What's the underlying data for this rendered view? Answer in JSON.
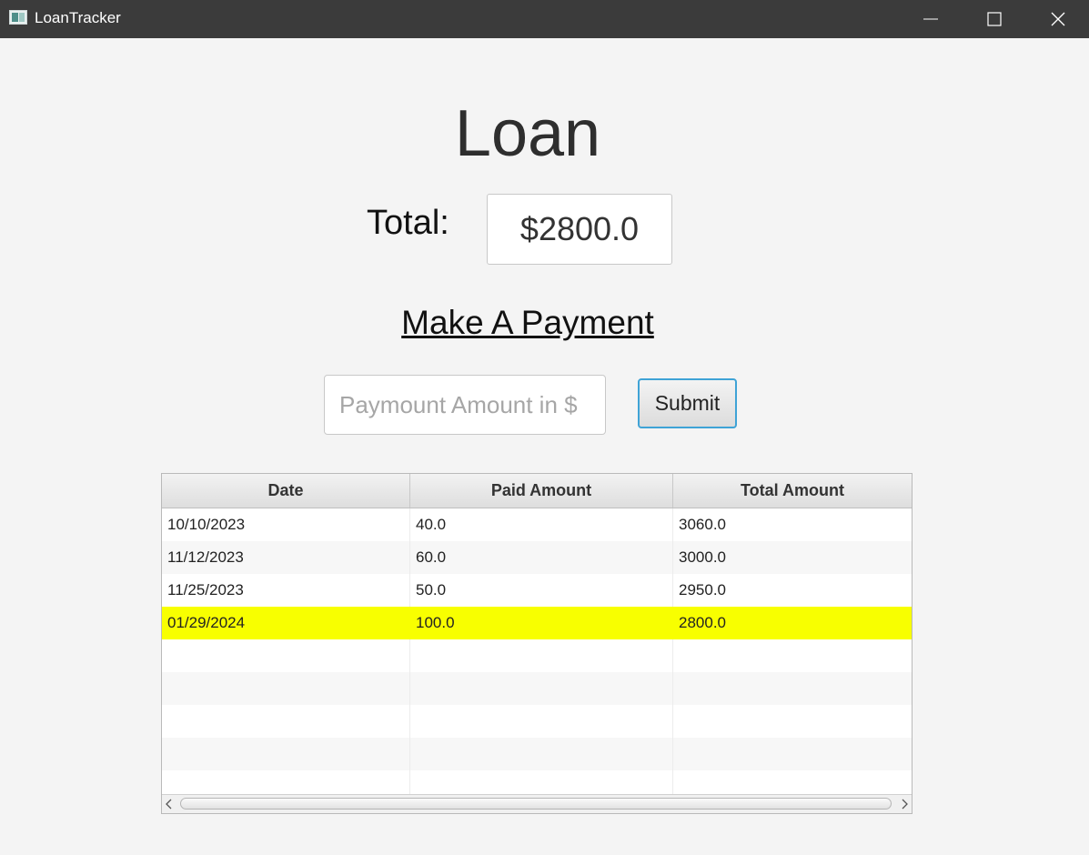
{
  "window": {
    "title": "LoanTracker",
    "icon": "app-window-icon",
    "controls": {
      "minimize": "minimize-icon",
      "maximize": "maximize-icon",
      "close": "close-icon"
    }
  },
  "main": {
    "heading": "Loan",
    "total_label": "Total:",
    "total_value": "$2800.0",
    "payment_heading": "Make A Payment",
    "payment_placeholder": "Paymount Amount in $",
    "payment_value": "",
    "submit_label": "Submit"
  },
  "table": {
    "columns": [
      "Date",
      "Paid Amount",
      "Total Amount"
    ],
    "rows": [
      [
        "10/10/2023",
        "40.0",
        "3060.0"
      ],
      [
        "11/12/2023",
        "60.0",
        "3000.0"
      ],
      [
        "11/25/2023",
        "50.0",
        "2950.0"
      ],
      [
        "01/29/2024",
        "100.0",
        "2800.0"
      ]
    ],
    "selected_row": 3,
    "selected_color": "#f8ff00"
  }
}
